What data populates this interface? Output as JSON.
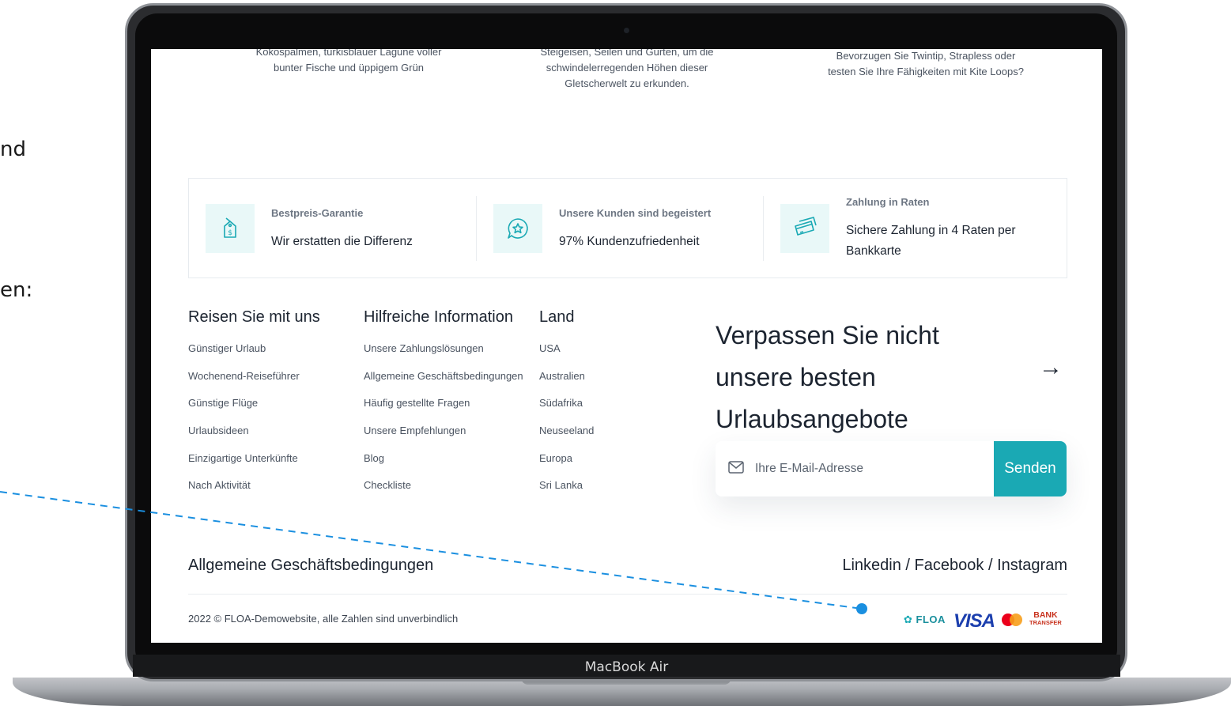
{
  "side_text": {
    "frag1": "nd",
    "frag2": "en:"
  },
  "laptop": {
    "label": "MacBook Air"
  },
  "captions": [
    {
      "line1": "Kokospalmen, türkisblauer Lagune voller",
      "line2": "bunter Fische und üppigem Grün"
    },
    {
      "line1": "Steigeisen, Seilen und Gurten, um die",
      "line2": "schwindelerregenden Höhen dieser",
      "line3": "Gletscherwelt zu erkunden."
    },
    {
      "line1": "Bevorzugen Sie Twintip, Strapless oder",
      "line2": "testen Sie Ihre Fähigkeiten mit Kite Loops?"
    }
  ],
  "features": [
    {
      "title": "Bestpreis-Garantie",
      "desc": "Wir erstatten die Differenz",
      "icon": "price-tag-icon"
    },
    {
      "title": "Unsere Kunden sind begeistert",
      "desc": "97% Kundenzufriedenheit",
      "icon": "star-chat-icon"
    },
    {
      "title": "Zahlung in Raten",
      "desc": "Sichere Zahlung in 4 Raten per Bankkarte",
      "icon": "credit-card-icon"
    }
  ],
  "columns": [
    {
      "heading": "Reisen Sie mit uns",
      "links": [
        "Günstiger Urlaub",
        "Wochenend-Reiseführer",
        "Günstige Flüge",
        "Urlaubsideen",
        "Einzigartige Unterkünfte",
        "Nach Aktivität"
      ]
    },
    {
      "heading": "Hilfreiche Information",
      "links": [
        "Unsere Zahlungslösungen",
        "Allgemeine Geschäftsbedingungen",
        "Häufig gestellte Fragen",
        "Unsere Empfehlungen",
        "Blog",
        "Checkliste"
      ]
    },
    {
      "heading": "Land",
      "links": [
        "USA",
        "Australien",
        "Südafrika",
        "Neuseeland",
        "Europa",
        "Sri Lanka"
      ]
    }
  ],
  "newsletter": {
    "title_line1": "Verpassen Sie nicht",
    "title_line2": "unsere besten",
    "title_line3": "Urlaubsangebote",
    "arrow": "→",
    "placeholder": "Ihre E-Mail-Adresse",
    "button": "Senden"
  },
  "footer": {
    "terms": "Allgemeine Geschäftsbedingungen",
    "social_linkedin": "Linkedin",
    "social_sep": "/",
    "social_facebook": "Facebook",
    "social_instagram": "Instagram",
    "copyright": "2022 © FLOA-Demowebsite, alle Zahlen sind unverbindlich",
    "payments": {
      "floa": "FLOA",
      "visa": "VISA",
      "bank_line1": "BANK",
      "bank_line2": "TRANSFER"
    }
  },
  "colors": {
    "accent": "#1aa9b4",
    "icon_bg": "#e9f8f8",
    "dashed_line": "#1a8fe0"
  }
}
